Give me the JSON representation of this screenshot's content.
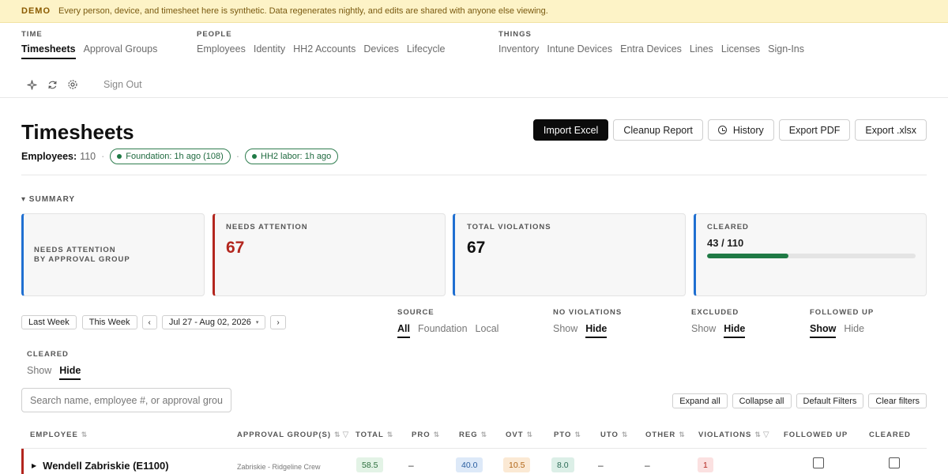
{
  "banner": {
    "tag": "DEMO",
    "message": "Every person, device, and timesheet here is synthetic. Data regenerates nightly, and edits are shared with anyone else viewing."
  },
  "nav": {
    "time": {
      "label": "TIME",
      "items": [
        "Timesheets",
        "Approval Groups"
      ]
    },
    "people": {
      "label": "PEOPLE",
      "items": [
        "Employees",
        "Identity",
        "HH2 Accounts",
        "Devices",
        "Lifecycle"
      ]
    },
    "things": {
      "label": "THINGS",
      "items": [
        "Inventory",
        "Intune Devices",
        "Entra Devices",
        "Lines",
        "Licenses",
        "Sign-Ins"
      ]
    }
  },
  "toolbar": {
    "sign_out": "Sign Out"
  },
  "page": {
    "title": "Timesheets"
  },
  "actions": {
    "import": "Import Excel",
    "cleanup": "Cleanup Report",
    "history": "History",
    "export_pdf": "Export PDF",
    "export_xlsx": "Export .xlsx"
  },
  "employees": {
    "label": "Employees:",
    "count": "110",
    "foundation_pill": "Foundation: 1h ago (108)",
    "hh2_pill": "HH2 labor: 1h ago"
  },
  "summary": {
    "toggle": "▾ SUMMARY",
    "cards": {
      "by_group": {
        "label_line1": "NEEDS ATTENTION",
        "label_line2": "BY APPROVAL GROUP"
      },
      "needs_attention": {
        "label": "NEEDS ATTENTION",
        "value": "67"
      },
      "total_violations": {
        "label": "TOTAL VIOLATIONS",
        "value": "67"
      },
      "cleared": {
        "label": "CLEARED",
        "value": "43 / 110",
        "progress": 0.39
      }
    }
  },
  "week": {
    "last": "Last Week",
    "this": "This Week",
    "prev": "‹",
    "range": "Jul 27 - Aug 02, 2026",
    "range_caret": "▾",
    "next": "›"
  },
  "filters": {
    "source": {
      "label": "SOURCE",
      "options": [
        "All",
        "Foundation",
        "Local"
      ]
    },
    "no_violations": {
      "label": "NO VIOLATIONS",
      "options": [
        "Show",
        "Hide"
      ]
    },
    "excluded": {
      "label": "EXCLUDED",
      "options": [
        "Show",
        "Hide"
      ]
    },
    "followed_up": {
      "label": "FOLLOWED UP",
      "options": [
        "Show",
        "Hide"
      ]
    },
    "cleared": {
      "label": "CLEARED",
      "options": [
        "Show",
        "Hide"
      ]
    }
  },
  "search": {
    "placeholder": "Search name, employee #, or approval grou"
  },
  "table_actions": {
    "expand": "Expand all",
    "collapse": "Collapse all",
    "defaults": "Default Filters",
    "clear": "Clear filters"
  },
  "table": {
    "headers": {
      "employee": "EMPLOYEE",
      "approval": "APPROVAL GROUP(S)",
      "total": "TOTAL",
      "pro": "PRO",
      "reg": "REG",
      "ovt": "OVT",
      "pto": "PTO",
      "uto": "UTO",
      "other": "OTHER",
      "violations": "VIOLATIONS",
      "followed_up": "FOLLOWED UP",
      "cleared": "CLEARED"
    },
    "rows": [
      {
        "name": "Wendell Zabriskie (E1100)",
        "group": "Zabriskie - Ridgeline Crew",
        "total": "58.5",
        "pro": "–",
        "reg": "40.0",
        "ovt": "10.5",
        "pto": "8.0",
        "uto": "–",
        "other": "–",
        "violations": "1"
      }
    ]
  },
  "colors": {
    "accent_blue": "#1f6fd1",
    "danger": "#b3261e",
    "success": "#1f7a45"
  }
}
